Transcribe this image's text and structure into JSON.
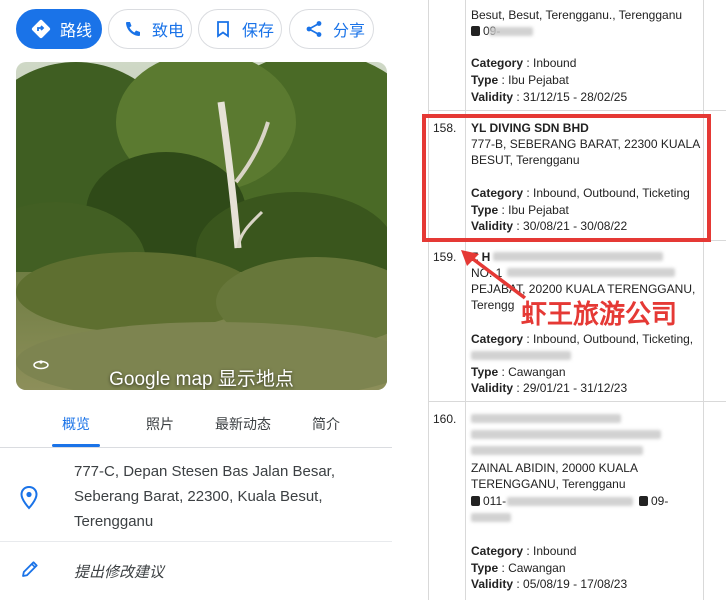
{
  "actions": {
    "route": "路线",
    "call": "致电",
    "save": "保存",
    "share": "分享"
  },
  "photo": {
    "caption": "Google map 显示地点"
  },
  "tabs": [
    "概览",
    "照片",
    "最新动态",
    "简介"
  ],
  "address": {
    "lines": [
      "777-C, Depan Stesen Bas Jalan Besar,",
      "Seberang Barat, 22300, Kuala Besut,",
      "Terengganu"
    ]
  },
  "suggest_edit": "提出修改建议",
  "annotation": "虾王旅游公司",
  "list": {
    "prev": {
      "addr_tail": "Besut, Besut, Terengganu., Terengganu",
      "phone": "09-",
      "category": "Inbound",
      "type": "Ibu Pejabat",
      "validity": "31/12/15 - 28/02/25"
    },
    "entries": [
      {
        "num": "158.",
        "name": "YL DIVING SDN BHD",
        "addr1": "777-B, SEBERANG BARAT, 22300 KUALA",
        "addr2": "BESUT, Terengganu",
        "category": "Inbound, Outbound, Ticketing",
        "type": "Ibu Pejabat",
        "validity": "30/08/21 - 30/08/22"
      },
      {
        "num": "159.",
        "name_partial": "Z H",
        "addr1": "NO. 1",
        "addr2": "PEJABAT, 20200 KUALA TERENGGANU,",
        "addr3": "Terengg",
        "category": "Inbound, Outbound, Ticketing,",
        "type": "Cawangan",
        "validity": "29/01/21 - 31/12/23"
      },
      {
        "num": "160.",
        "addr3": "ZAINAL ABIDIN, 20000 KUALA",
        "addr4": "TERENGGANU, Terengganu",
        "phone": "011-",
        "fax": "09-",
        "category": "Inbound",
        "type": "Cawangan",
        "validity": "05/08/19 - 17/08/23"
      }
    ],
    "labels": {
      "category": "Category",
      "type": "Type",
      "validity": "Validity"
    }
  },
  "colors": {
    "accent": "#1a73e8",
    "highlight": "#e53935"
  }
}
